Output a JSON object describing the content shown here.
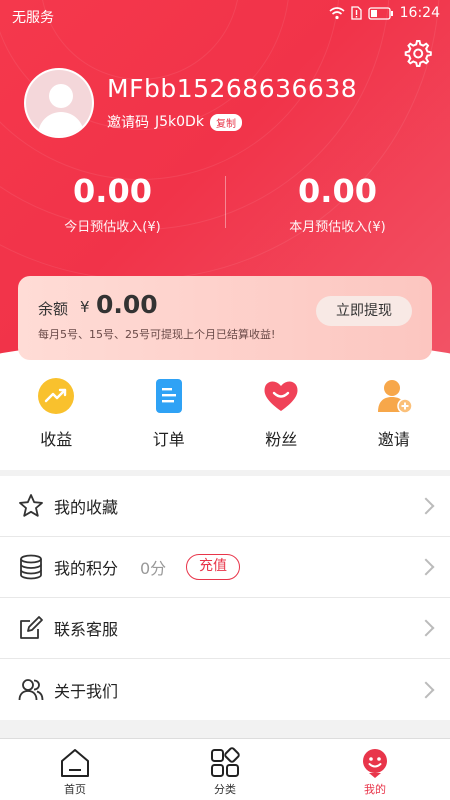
{
  "status_bar": {
    "carrier": "无服务",
    "time": "16:24"
  },
  "profile": {
    "username": "MFbb15268636638",
    "invite_label": "邀请码",
    "invite_code": "J5k0Dk",
    "copy_label": "复制"
  },
  "income": {
    "today_value": "0.00",
    "today_label": "今日预估收入(¥)",
    "month_value": "0.00",
    "month_label": "本月预估收入(¥)"
  },
  "balance": {
    "label": "余额",
    "currency": "¥",
    "value": "0.00",
    "note": "每月5号、15号、25号可提现上个月已结算收益!",
    "withdraw_label": "立即提现"
  },
  "actions": [
    {
      "label": "收益",
      "icon": "trending-up-icon",
      "color": "#f9c12d"
    },
    {
      "label": "订单",
      "icon": "document-icon",
      "color": "#2fa2f5"
    },
    {
      "label": "粉丝",
      "icon": "heart-icon",
      "color": "#f04258"
    },
    {
      "label": "邀请",
      "icon": "add-user-icon",
      "color": "#f7a74a"
    }
  ],
  "menu": [
    {
      "label": "我的收藏",
      "icon": "star-icon"
    },
    {
      "label": "我的积分",
      "icon": "database-icon",
      "extra": "0分",
      "button": "充值"
    },
    {
      "label": "联系客服",
      "icon": "edit-icon"
    },
    {
      "label": "关于我们",
      "icon": "users-icon"
    }
  ],
  "tabs": [
    {
      "label": "首页",
      "icon": "home-icon"
    },
    {
      "label": "分类",
      "icon": "category-icon"
    },
    {
      "label": "我的",
      "icon": "profile-icon",
      "active": true
    }
  ],
  "colors": {
    "brand": "#e8354a",
    "header": "#f13349",
    "card": "#fcc6c0"
  }
}
